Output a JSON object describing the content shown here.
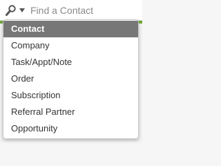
{
  "search": {
    "placeholder": "Find a Contact",
    "value": ""
  },
  "colors": {
    "accent": "#6fa83a",
    "selected_bg": "#777777"
  },
  "icons": {
    "search": "search-icon",
    "dropdown": "chevron-down-icon"
  },
  "menu": {
    "selected": "Contact",
    "items": [
      {
        "label": "Contact"
      },
      {
        "label": "Company"
      },
      {
        "label": "Task/Appt/Note"
      },
      {
        "label": "Order"
      },
      {
        "label": "Subscription"
      },
      {
        "label": "Referral Partner"
      },
      {
        "label": "Opportunity"
      }
    ]
  }
}
